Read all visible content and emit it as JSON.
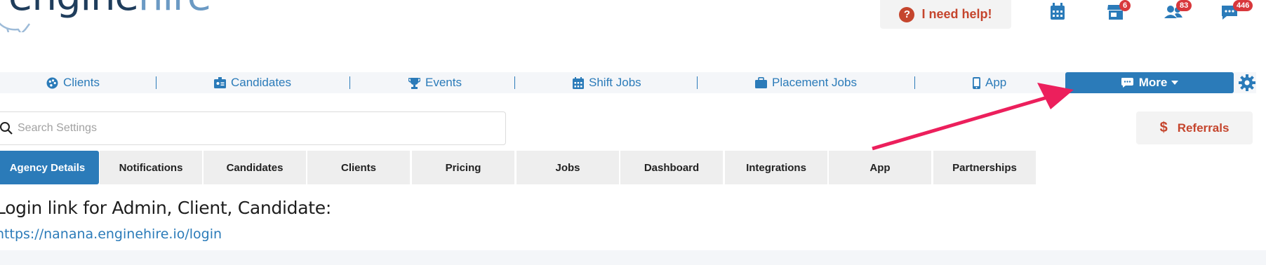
{
  "brand": {
    "logo_part1": "engine",
    "logo_part2": "hire"
  },
  "header": {
    "help_label": "I need help!",
    "icons": [
      {
        "name": "calendar-icon",
        "badge": ""
      },
      {
        "name": "store-icon",
        "badge": "6"
      },
      {
        "name": "users-icon",
        "badge": "83"
      },
      {
        "name": "chat-icon",
        "badge": "446"
      }
    ]
  },
  "nav": {
    "items": [
      {
        "label": "Clients",
        "icon": "palette-icon"
      },
      {
        "label": "Candidates",
        "icon": "id-card-icon"
      },
      {
        "label": "Events",
        "icon": "trophy-icon"
      },
      {
        "label": "Shift Jobs",
        "icon": "calendar-icon"
      },
      {
        "label": "Placement Jobs",
        "icon": "briefcase-icon"
      },
      {
        "label": "App",
        "icon": "mobile-icon"
      }
    ],
    "more_label": "More"
  },
  "search": {
    "placeholder": "Search Settings",
    "value": ""
  },
  "referrals_label": "Referrals",
  "tabs": [
    {
      "label": "Agency Details",
      "active": true
    },
    {
      "label": "Notifications"
    },
    {
      "label": "Candidates"
    },
    {
      "label": "Clients"
    },
    {
      "label": "Pricing"
    },
    {
      "label": "Jobs"
    },
    {
      "label": "Dashboard"
    },
    {
      "label": "Integrations"
    },
    {
      "label": "App"
    },
    {
      "label": "Partnerships"
    }
  ],
  "content": {
    "login_heading": "Login link for Admin, Client, Candidate:",
    "login_url": "https://nanana.enginehire.io/login"
  },
  "colors": {
    "primary": "#2b7bb9",
    "help": "#c5452d",
    "badge": "#d8383c",
    "annotation_arrow": "#ec1f5c"
  }
}
